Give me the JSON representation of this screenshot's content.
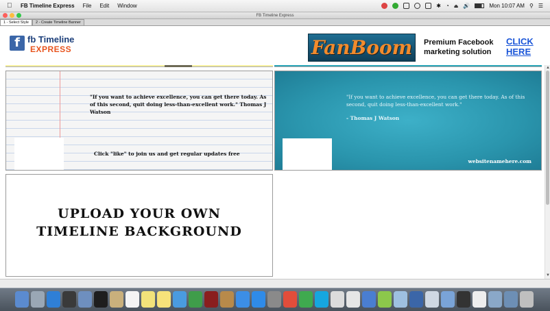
{
  "menubar": {
    "app_name": "FB Timeline Express",
    "menus": [
      "File",
      "Edit",
      "Window"
    ],
    "clock": "Mon 10:07 AM"
  },
  "window": {
    "title": "FB Timeline Express"
  },
  "tabs": [
    {
      "label": "1 - Select Style",
      "active": true
    },
    {
      "label": "2 - Create Timeline Banner",
      "active": false
    }
  ],
  "header": {
    "logo_line1": "fb Timeline",
    "logo_line2": "EXPRESS",
    "logo_icon": "f",
    "ad_brand": "FanBoom",
    "ad_text_line1": "Premium Facebook",
    "ad_text_line2": "marketing solution",
    "cta_line1": "CLICK",
    "cta_line2": "HERE"
  },
  "gallery": {
    "card_notebook": {
      "quote": "\"If you want to achieve excellence, you can get there today. As of this second, quit doing less-than-excellent work.\" Thomas J Watson",
      "cta": "Click \"like\" to join us and get regular updates free"
    },
    "card_teal": {
      "quote": "\"If you want to achieve excellence, you can get there today. As of this second, quit doing less-than-excellent work.\"",
      "author": "- Thomas J Watson",
      "site": "websitenamehere.com"
    },
    "card_upload": {
      "line1": "UPLOAD YOUR OWN",
      "line2": "TIMELINE BACKGROUND"
    }
  },
  "colors": {
    "brand_blue": "#1c3f7a",
    "brand_orange": "#e8541e",
    "link_blue": "#1a55d8",
    "teal": "#2a95ad"
  },
  "dock_icons": [
    "finder-icon",
    "launchpad-icon",
    "safari-icon",
    "dashboard-icon",
    "preview-icon",
    "terminal-icon",
    "script-icon",
    "calendar-icon",
    "textedit-icon",
    "notes-icon",
    "messages-icon",
    "facetime-icon",
    "photobooth-icon",
    "contacts-icon",
    "itunes-icon",
    "appstore-icon",
    "settings-icon",
    "chrome-icon",
    "google-icon",
    "skype-icon",
    "scripts-icon",
    "database-icon",
    "xcode-icon",
    "android-icon",
    "folder-icon",
    "fb-timeline-icon",
    "screenshot-icon",
    "finder-window-icon",
    "calculator-icon",
    "document-icon",
    "finder2-icon",
    "downloads-icon",
    "trash-icon"
  ]
}
